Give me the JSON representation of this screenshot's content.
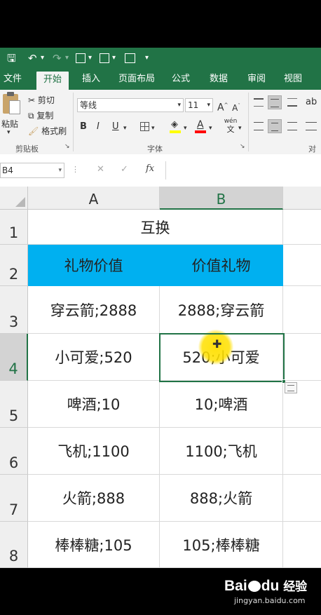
{
  "quick_access": {
    "save": "🖫",
    "undo": "↶",
    "redo": "↷",
    "more": "▾"
  },
  "tabs": [
    "文件",
    "开始",
    "插入",
    "页面布局",
    "公式",
    "数据",
    "审阅",
    "视图"
  ],
  "ribbon": {
    "paste": "粘贴",
    "cut": "剪切",
    "copy": "复制",
    "format_painter": "格式刷",
    "clipboard_group": "剪贴板",
    "font_name": "等线",
    "font_size": "11",
    "grow": "A",
    "shrink": "A",
    "bold": "B",
    "italic": "I",
    "underline": "U",
    "wen": "wén",
    "wen_sub": "文",
    "font_group": "字体",
    "align_group": "对齐",
    "fill_color": "#ffff00",
    "font_color": "#ff0000"
  },
  "formula_bar": {
    "name_box": "B4",
    "fx": "fx",
    "cancel": "✕",
    "enter": "✓"
  },
  "columns": [
    "A",
    "B"
  ],
  "rows": [
    "1",
    "2",
    "3",
    "4",
    "5",
    "6",
    "7",
    "8"
  ],
  "cells": {
    "title": "互换",
    "header_a": "礼物价值",
    "header_b": "价值礼物",
    "a": [
      "穿云箭;2888",
      "小可爱;520",
      "啤酒;10",
      "飞机;1100",
      "火箭;888",
      "棒棒糖;105"
    ],
    "b": [
      "2888;穿云箭",
      "520;小可爱",
      "10;啤酒",
      "1100;飞机",
      "888;火箭",
      "105;棒棒糖"
    ]
  },
  "selected_cell": "B4",
  "colors": {
    "ribbon": "#217346",
    "header_fill": "#00b0f0",
    "highlight": "#ffe000"
  },
  "watermark": {
    "brand": "Bai",
    "paw": "du",
    "suffix": "经验",
    "url": "jingyan.baidu.com"
  }
}
